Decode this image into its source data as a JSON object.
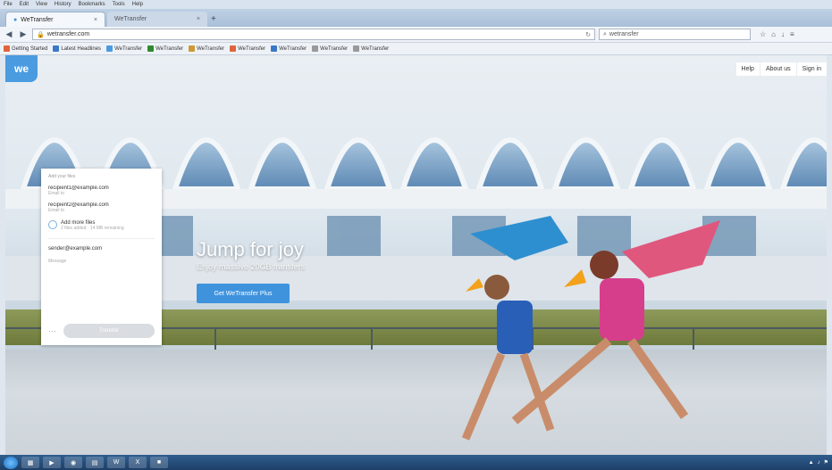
{
  "browser": {
    "menu": [
      "File",
      "Edit",
      "View",
      "History",
      "Bookmarks",
      "Tools",
      "Help"
    ],
    "tabs": [
      {
        "label": "WeTransfer",
        "active": true
      },
      {
        "label": "WeTransfer",
        "active": false
      }
    ],
    "url": "wetransfer.com",
    "search_placeholder": "wetransfer",
    "bookmarks": [
      "Getting Started",
      "Latest Headlines",
      "WeTransfer",
      "WeTransfer",
      "WeTransfer",
      "WeTransfer",
      "WeTransfer",
      "WeTransfer",
      "WeTransfer"
    ]
  },
  "site": {
    "logo": "we",
    "nav": [
      "Help",
      "About us",
      "Sign in"
    ],
    "hero_title": "Jump for joy",
    "hero_sub": "Enjoy massive 20GB transfers",
    "hero_button": "Get WeTransfer Plus"
  },
  "panel": {
    "recipients_label": "Add your files",
    "recipients": [
      {
        "email": "recipient1@example.com",
        "sub": "Email to"
      },
      {
        "email": "recipient2@example.com",
        "sub": "Email to"
      }
    ],
    "file": {
      "name": "Add more files",
      "meta": "2 files added · 14 MB remaining"
    },
    "your_email": "sender@example.com",
    "message_placeholder": "Message",
    "transfer_button": "Transfer"
  },
  "colors": {
    "accent": "#3f93dd",
    "logo_bg": "#4a9be0"
  }
}
